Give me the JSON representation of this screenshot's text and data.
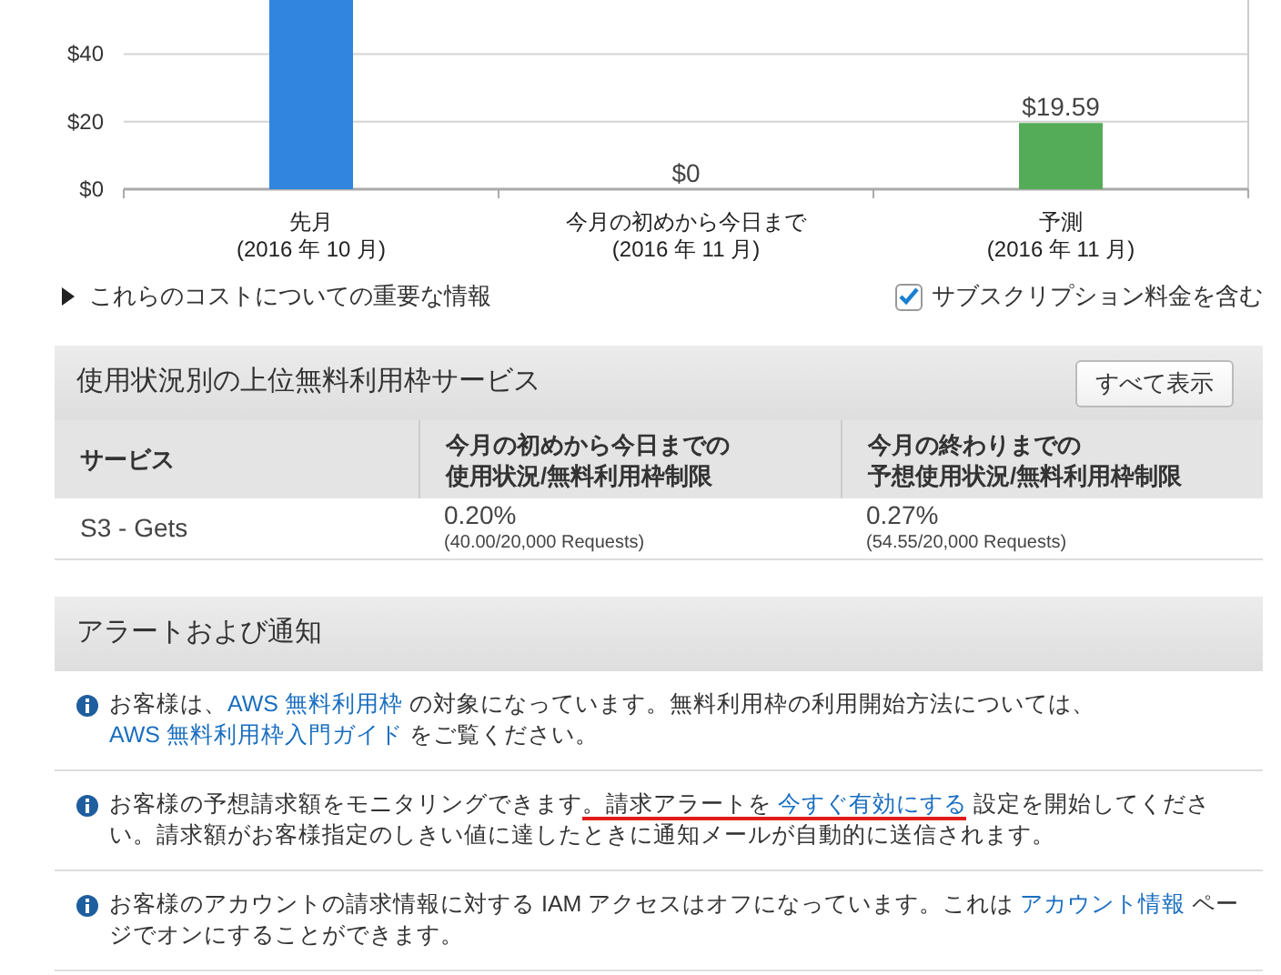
{
  "cost_chart": {
    "chart_data": {
      "type": "bar",
      "categories": [
        "先月\n(2016 年 10 月)",
        "今月の初めから今日まで\n(2016 年 11 月)",
        "予測\n(2016 年 11 月)"
      ],
      "series": [
        {
          "values": [
            56,
            0,
            19.59
          ],
          "colors": [
            "#3185de",
            "#3185de",
            "#55ac58"
          ]
        }
      ],
      "ylim": [
        0,
        56
      ],
      "yticks": [
        {
          "value": 0,
          "label": "$0"
        },
        {
          "value": 20,
          "label": "$20"
        },
        {
          "value": 40,
          "label": "$40"
        }
      ],
      "value_labels": [
        null,
        "$0",
        "$19.59"
      ]
    }
  },
  "cost_info": {
    "label": "これらのコストについての重要な情報",
    "expanded": false
  },
  "subscription_checkbox": {
    "label": "サブスクリプション料金を含む",
    "checked": true
  },
  "free_tier_panel": {
    "title": "使用状況別の上位無料利用枠サービス",
    "button": "すべて表示",
    "columns": [
      [
        "サービス"
      ],
      [
        "今月の初めから今日までの",
        "使用状況/無料利用枠制限"
      ],
      [
        "今月の終わりまでの",
        "予想使用状況/無料利用枠制限"
      ]
    ],
    "rows": [
      {
        "service": "S3 - Gets",
        "month_to_date": {
          "percent": "0.20%",
          "detail": "(40.00/20,000 Requests)"
        },
        "forecast": {
          "percent": "0.27%",
          "detail": "(54.55/20,000 Requests)"
        }
      }
    ]
  },
  "alerts_panel": {
    "title": "アラートおよび通知",
    "items": [
      {
        "segments": [
          {
            "text": "お客様は、",
            "kind": "text"
          },
          {
            "text": "AWS 無料利用枠",
            "kind": "link"
          },
          {
            "text": " の対象になっています。無料利用枠の利用開始方法については、",
            "kind": "text"
          },
          {
            "text": "AWS 無料利用枠入門ガイド",
            "kind": "link"
          },
          {
            "text": " をご覧ください。",
            "kind": "text"
          }
        ]
      },
      {
        "segments": [
          {
            "text": "お客様の予想請求額をモニタリングできます",
            "kind": "text"
          },
          {
            "text": "。請求アラートを ",
            "kind": "underlined_text"
          },
          {
            "text": "今すぐ有効にする",
            "kind": "underlined_link"
          },
          {
            "text": " 設定を開始してください。請求額がお客様指定のしきい値に達したときに通知メールが自動的に送信されます。",
            "kind": "text"
          }
        ]
      },
      {
        "segments": [
          {
            "text": "お客様のアカウントの請求情報に対する IAM アクセスはオフになっています。これは ",
            "kind": "text"
          },
          {
            "text": "アカウント情報",
            "kind": "link"
          },
          {
            "text": " ページでオンにすることができます。",
            "kind": "text"
          }
        ]
      }
    ]
  }
}
